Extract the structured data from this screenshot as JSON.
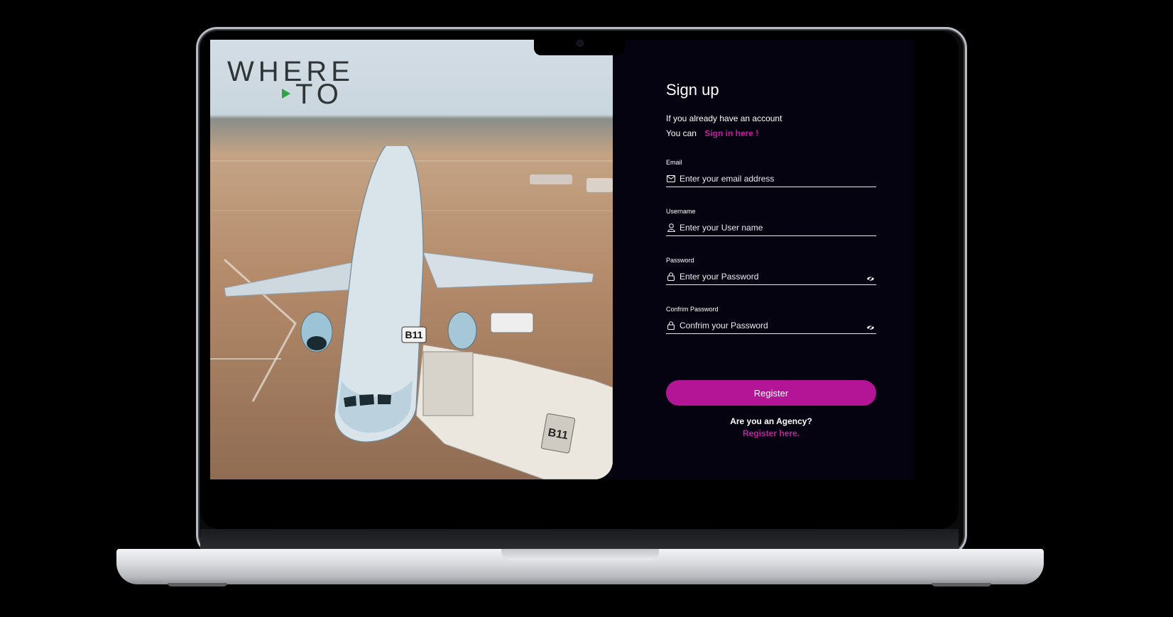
{
  "brand": {
    "logo_line1": "WHERE",
    "logo_line2": "TO",
    "logo_colors": {
      "text": "#2f3537",
      "arrow": "#2ea343"
    }
  },
  "form": {
    "title": "Sign up",
    "subtitle": "If you already have an account",
    "signin_prefix": "You can",
    "signin_link": "Sign in here !",
    "fields": [
      {
        "label": "Email",
        "placeholder": "Enter your email address",
        "icon": "mail-icon"
      },
      {
        "label": "Username",
        "placeholder": "Enter your User name",
        "icon": "user-icon"
      },
      {
        "label": "Password",
        "placeholder": "Enter your Password",
        "icon": "lock-icon",
        "toggle_icon": "eye-off-icon"
      },
      {
        "label": "Confrim Password",
        "placeholder": "Confrim your Password",
        "icon": "lock-icon",
        "toggle_icon": "eye-off-icon"
      }
    ],
    "register_label": "Register",
    "agency_question": "Are you an Agency?",
    "agency_link": "Register here."
  },
  "hero": {
    "gate_sign": "B11",
    "gate_sign_2": "B11"
  },
  "colors": {
    "accent": "#b31596",
    "link": "#c21ea0",
    "panel_bg": "#05030f"
  }
}
